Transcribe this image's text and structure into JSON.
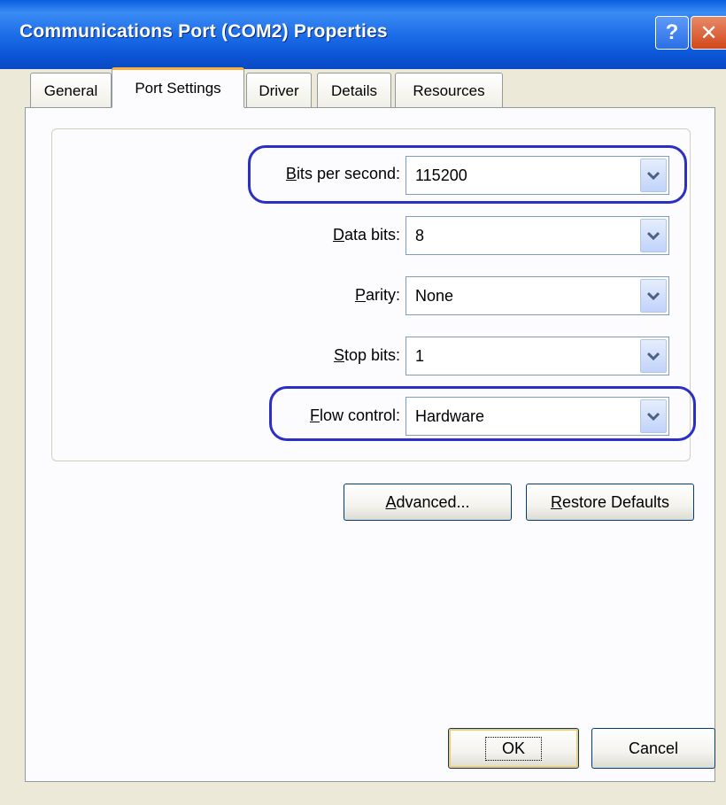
{
  "window": {
    "title": "Communications Port (COM2) Properties",
    "help_label": "?",
    "close_label": "✕"
  },
  "tabs": [
    {
      "label": "General"
    },
    {
      "label": "Port Settings",
      "active": true
    },
    {
      "label": "Driver"
    },
    {
      "label": "Details"
    },
    {
      "label": "Resources"
    }
  ],
  "settings": {
    "bits_per_second": {
      "label_key": "B",
      "label_rest": "its per second:",
      "value": "115200"
    },
    "data_bits": {
      "label_key": "D",
      "label_rest": "ata bits:",
      "value": "8"
    },
    "parity": {
      "label_key": "P",
      "label_rest": "arity:",
      "value": "None"
    },
    "stop_bits": {
      "label_key": "S",
      "label_rest": "top bits:",
      "value": "1"
    },
    "flow_control": {
      "label_key": "F",
      "label_rest": "low control:",
      "value": "Hardware"
    }
  },
  "buttons": {
    "advanced": {
      "key": "A",
      "rest": "dvanced..."
    },
    "restore": {
      "key": "R",
      "rest": "estore Defaults"
    },
    "ok": "OK",
    "cancel": "Cancel"
  },
  "colors": {
    "highlight": "#2b2fc4",
    "titlebar": "#0b55d6"
  }
}
